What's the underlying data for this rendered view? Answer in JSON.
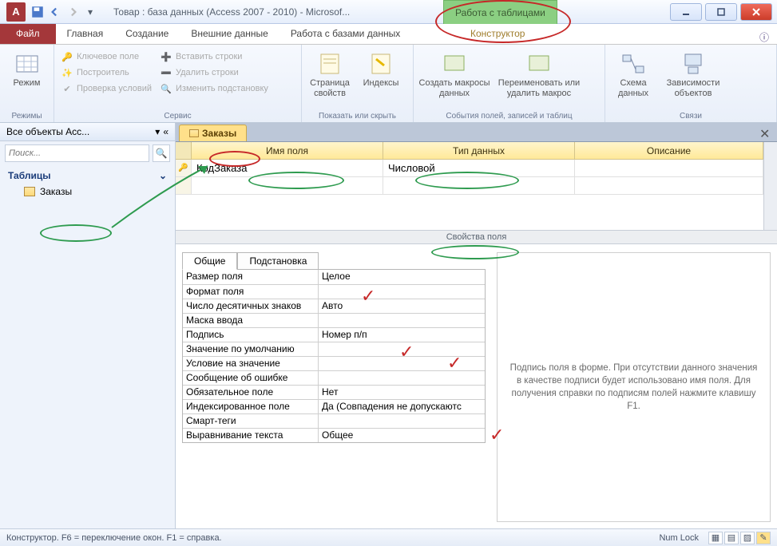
{
  "titlebar": {
    "app_letter": "A",
    "title": "Товар : база данных (Access 2007 - 2010) - Microsof...",
    "contextual": "Работа с таблицами"
  },
  "ribbon_tabs": {
    "file": "Файл",
    "home": "Главная",
    "create": "Создание",
    "external": "Внешние данные",
    "dbtools": "Работа с базами данных",
    "design": "Конструктор"
  },
  "ribbon_groups": {
    "views": {
      "label": "Режимы",
      "btn_view": "Режим"
    },
    "tools": {
      "label": "Сервис",
      "primary_key": "Ключевое поле",
      "builder": "Построитель",
      "test_rules": "Проверка условий",
      "insert_rows": "Вставить строки",
      "delete_rows": "Удалить строки",
      "modify_lookup": "Изменить подстановку"
    },
    "showhide": {
      "label": "Показать или скрыть",
      "prop_sheet": "Страница свойств",
      "indexes": "Индексы"
    },
    "events": {
      "label": "События полей, записей и таблиц",
      "create_macro": "Создать макросы данных",
      "rename_macro": "Переименовать или удалить макрос"
    },
    "relations": {
      "label": "Связи",
      "rel": "Схема данных",
      "deps": "Зависимости объектов"
    }
  },
  "nav": {
    "header": "Все объекты Acc...",
    "search_placeholder": "Поиск...",
    "section": "Таблицы",
    "item": "Заказы"
  },
  "doc": {
    "tab": "Заказы",
    "col_name": "Имя поля",
    "col_type": "Тип данных",
    "col_desc": "Описание",
    "row_field": "КодЗаказа",
    "row_type": "Числовой"
  },
  "props": {
    "header": "Свойства поля",
    "tab_general": "Общие",
    "tab_lookup": "Подстановка",
    "rows": [
      {
        "label": "Размер поля",
        "value": "Целое"
      },
      {
        "label": "Формат поля",
        "value": ""
      },
      {
        "label": "Число десятичных знаков",
        "value": "Авто"
      },
      {
        "label": "Маска ввода",
        "value": ""
      },
      {
        "label": "Подпись",
        "value": "Номер п/п"
      },
      {
        "label": "Значение по умолчанию",
        "value": ""
      },
      {
        "label": "Условие на значение",
        "value": ""
      },
      {
        "label": "Сообщение об ошибке",
        "value": ""
      },
      {
        "label": "Обязательное поле",
        "value": "Нет"
      },
      {
        "label": "Индексированное поле",
        "value": "Да (Совпадения не допускаютс"
      },
      {
        "label": "Смарт-теги",
        "value": ""
      },
      {
        "label": "Выравнивание текста",
        "value": "Общее"
      }
    ],
    "help_text": "Подпись поля в форме. При отсутствии данного значения в качестве подписи будет использовано имя поля. Для получения справки по подписям полей нажмите клавишу F1."
  },
  "status": {
    "text": "Конструктор.   F6 = переключение окон.   F1 = справка.",
    "numlock": "Num Lock"
  }
}
